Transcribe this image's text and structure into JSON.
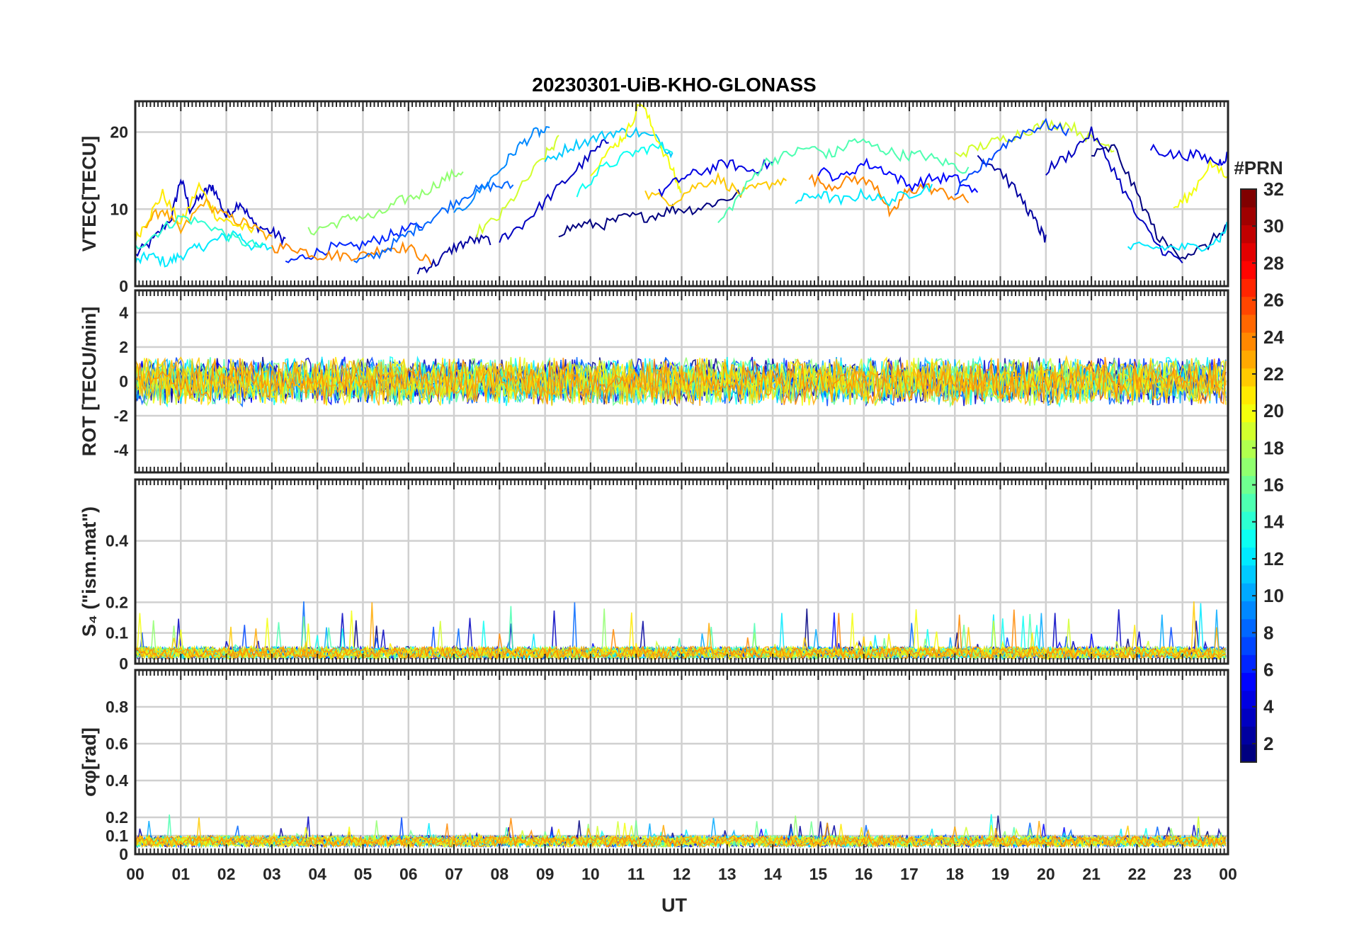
{
  "chart_data": {
    "type": "line",
    "title": "20230301-UiB-KHO-GLONASS",
    "xlabel": "UT",
    "x_ticks": [
      "00",
      "01",
      "02",
      "03",
      "04",
      "05",
      "06",
      "07",
      "08",
      "09",
      "10",
      "11",
      "12",
      "13",
      "14",
      "15",
      "16",
      "17",
      "18",
      "19",
      "20",
      "21",
      "22",
      "23",
      "00"
    ],
    "xlim": [
      0,
      24
    ],
    "grid": true,
    "colorbar": {
      "label": "#PRN",
      "range": [
        1,
        32
      ],
      "ticks": [
        "2",
        "4",
        "6",
        "8",
        "10",
        "12",
        "14",
        "16",
        "18",
        "20",
        "22",
        "24",
        "26",
        "28",
        "30",
        "32"
      ]
    },
    "panels": [
      {
        "id": "vtec",
        "ylabel": "VTEC[TECU]",
        "ylim": [
          0,
          24
        ],
        "yticks": [
          "0",
          "10",
          "20"
        ],
        "series": [
          {
            "prn": 3,
            "x": [
              0.0,
              0.4,
              0.8,
              1.0,
              1.2,
              1.5,
              1.7,
              2.0,
              2.3,
              2.6,
              3.0,
              3.3
            ],
            "y": [
              4,
              6,
              9,
              14,
              10,
              12,
              13,
              9,
              11,
              8,
              7,
              6
            ]
          },
          {
            "prn": 12,
            "x": [
              0.0,
              0.3,
              0.7,
              1.0,
              1.4,
              1.8,
              2.2,
              2.6,
              3.0
            ],
            "y": [
              3,
              4,
              3,
              4,
              5,
              6,
              7,
              5,
              5
            ]
          },
          {
            "prn": 21,
            "x": [
              0.0,
              0.3,
              0.6,
              1.0,
              1.4,
              1.8,
              2.2,
              2.6
            ],
            "y": [
              6,
              9,
              12,
              8,
              13,
              9,
              8,
              7
            ]
          },
          {
            "prn": 23,
            "x": [
              0.2,
              0.6,
              1.0,
              1.5,
              2.0,
              2.5,
              3.0
            ],
            "y": [
              8,
              10,
              7,
              11,
              9,
              8,
              6
            ]
          },
          {
            "prn": 14,
            "x": [
              0.0,
              0.5,
              1.0,
              1.6,
              2.2,
              2.8
            ],
            "y": [
              5,
              7,
              9,
              8,
              6,
              5
            ]
          },
          {
            "prn": 6,
            "x": [
              3.3,
              3.8,
              4.3,
              4.8,
              5.3,
              5.8,
              6.3
            ],
            "y": [
              3,
              4,
              5,
              5,
              6,
              7,
              8
            ]
          },
          {
            "prn": 24,
            "x": [
              3.0,
              3.5,
              4.0,
              4.5,
              5.0,
              5.5,
              6.0,
              6.5
            ],
            "y": [
              5,
              5,
              4,
              4,
              4,
              5,
              5,
              3
            ]
          },
          {
            "prn": 17,
            "x": [
              3.8,
              4.3,
              4.8,
              5.3,
              5.8,
              6.3,
              6.8,
              7.2
            ],
            "y": [
              7,
              8,
              9,
              9,
              11,
              12,
              14,
              15
            ]
          },
          {
            "prn": 8,
            "x": [
              4.8,
              5.3,
              5.8,
              6.3,
              6.8,
              7.3,
              7.8,
              8.3
            ],
            "y": [
              3,
              4,
              6,
              8,
              10,
              12,
              13,
              13
            ]
          },
          {
            "prn": 2,
            "x": [
              6.2,
              6.6,
              7.0,
              7.4,
              7.8
            ],
            "y": [
              2,
              3,
              5,
              6,
              6
            ]
          },
          {
            "prn": 9,
            "x": [
              7.0,
              7.5,
              8.0,
              8.4,
              8.8,
              9.1
            ],
            "y": [
              9,
              12,
              15,
              18,
              20,
              20
            ]
          },
          {
            "prn": 19,
            "x": [
              7.5,
              8.0,
              8.5,
              9.0,
              9.3
            ],
            "y": [
              7,
              9,
              13,
              17,
              19
            ]
          },
          {
            "prn": 3,
            "x": [
              8.0,
              8.5,
              9.0,
              9.5,
              10.0,
              10.4
            ],
            "y": [
              6,
              8,
              11,
              14,
              17,
              19
            ]
          },
          {
            "prn": 1,
            "x": [
              9.3,
              9.8,
              10.3,
              10.8,
              11.3,
              11.8,
              12.3,
              12.8,
              13.3
            ],
            "y": [
              7,
              8,
              8,
              9,
              9,
              10,
              10,
              11,
              12
            ]
          },
          {
            "prn": 11,
            "x": [
              9.0,
              9.5,
              10.0,
              10.5,
              11.0,
              11.5,
              11.8
            ],
            "y": [
              16,
              18,
              19,
              20,
              20,
              19,
              17
            ]
          },
          {
            "prn": 20,
            "x": [
              10.0,
              10.5,
              10.8,
              11.1,
              11.4,
              11.8,
              12.0
            ],
            "y": [
              15,
              18,
              20,
              24,
              20,
              15,
              12
            ]
          },
          {
            "prn": 13,
            "x": [
              9.7,
              10.2,
              10.8,
              11.3,
              11.8
            ],
            "y": [
              12,
              15,
              17,
              18,
              18
            ]
          },
          {
            "prn": 22,
            "x": [
              11.2,
              11.8,
              12.3,
              12.8,
              13.3,
              13.8,
              14.3
            ],
            "y": [
              12,
              11,
              13,
              14,
              12,
              13,
              14
            ]
          },
          {
            "prn": 4,
            "x": [
              11.5,
              12.0,
              12.5,
              13.0,
              13.5,
              14.0
            ],
            "y": [
              12,
              14,
              15,
              16,
              15,
              16
            ]
          },
          {
            "prn": 15,
            "x": [
              12.8,
              13.3,
              13.8,
              14.3,
              14.8,
              15.3,
              15.8,
              16.3,
              16.8,
              17.3,
              17.8,
              18.3
            ],
            "y": [
              8,
              12,
              16,
              17,
              18,
              17,
              19,
              18,
              17,
              17,
              16,
              15
            ]
          },
          {
            "prn": 24,
            "x": [
              14.8,
              15.3,
              15.8,
              16.3,
              16.6,
              16.9,
              17.3,
              17.8,
              18.3
            ],
            "y": [
              14,
              13,
              14,
              13,
              9,
              12,
              13,
              12,
              11
            ]
          },
          {
            "prn": 12,
            "x": [
              14.5,
              15.0,
              15.5,
              16.0,
              16.5,
              17.0,
              17.5
            ],
            "y": [
              11,
              12,
              11,
              12,
              11,
              12,
              13
            ]
          },
          {
            "prn": 5,
            "x": [
              15.0,
              15.5,
              16.0,
              16.5,
              17.0,
              17.5,
              18.0,
              18.5
            ],
            "y": [
              15,
              14,
              16,
              15,
              13,
              14,
              14,
              12
            ]
          },
          {
            "prn": 19,
            "x": [
              18.0,
              18.5,
              19.0,
              19.5,
              20.0,
              20.5,
              21.0,
              21.5
            ],
            "y": [
              17,
              18,
              19,
              20,
              21,
              21,
              19,
              18
            ]
          },
          {
            "prn": 2,
            "x": [
              18.5,
              19.0,
              19.5,
              19.8,
              20.0
            ],
            "y": [
              17,
              15,
              11,
              8,
              6
            ]
          },
          {
            "prn": 7,
            "x": [
              18.0,
              18.5,
              19.0,
              19.5,
              20.0,
              20.5
            ],
            "y": [
              12,
              15,
              18,
              20,
              21,
              20
            ]
          },
          {
            "prn": 3,
            "x": [
              20.0,
              20.5,
              21.0,
              21.5,
              22.0,
              22.5,
              23.0
            ],
            "y": [
              15,
              17,
              20,
              15,
              9,
              5,
              3
            ]
          },
          {
            "prn": 1,
            "x": [
              21.0,
              21.5,
              22.0,
              22.5,
              23.0,
              23.5,
              24.0
            ],
            "y": [
              17,
              18,
              12,
              6,
              4,
              5,
              8
            ]
          },
          {
            "prn": 12,
            "x": [
              21.8,
              22.3,
              22.8,
              23.3,
              23.8,
              24.0
            ],
            "y": [
              5,
              5,
              5,
              5,
              6,
              8
            ]
          },
          {
            "prn": 20,
            "x": [
              22.8,
              23.2,
              23.6,
              24.0
            ],
            "y": [
              10,
              12,
              16,
              14
            ]
          },
          {
            "prn": 4,
            "x": [
              22.3,
              22.8,
              23.3,
              23.8,
              24.0
            ],
            "y": [
              18,
              17,
              17,
              16,
              17
            ]
          }
        ]
      },
      {
        "id": "rot",
        "ylabel": "ROT [TECU/min]",
        "ylim": [
          -5.3,
          5.3
        ],
        "yticks": [
          "-4",
          "-2",
          "0",
          "2",
          "4"
        ],
        "series": []
      },
      {
        "id": "s4",
        "ylabel": "S₄ (\"ism.mat\")",
        "ylim": [
          0,
          0.6
        ],
        "yticks": [
          "0",
          "0.1",
          "0.2",
          "0.4"
        ],
        "series": []
      },
      {
        "id": "sigphi",
        "ylabel": "σφ[rad]",
        "ylim": [
          0,
          1.0
        ],
        "yticks": [
          "0",
          "0.1",
          "0.2",
          "0.4",
          "0.6",
          "0.8"
        ],
        "series": []
      }
    ]
  }
}
